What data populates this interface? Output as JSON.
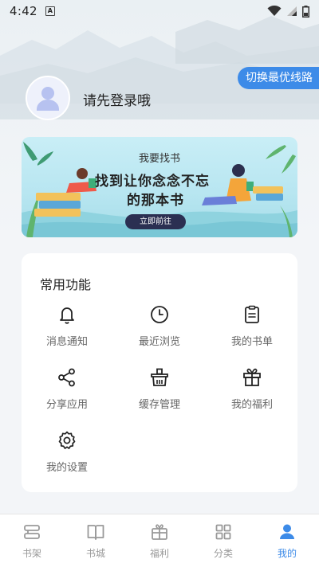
{
  "status_bar": {
    "time": "4:42",
    "notification_letter": "A"
  },
  "route_button": {
    "label": "切换最优线路"
  },
  "profile": {
    "login_prompt": "请先登录哦"
  },
  "banner": {
    "subtitle": "我要找书",
    "title_line1": "找到让你念念不忘",
    "title_line2": "的那本书",
    "button_label": "立即前往"
  },
  "functions": {
    "title": "常用功能",
    "items": [
      {
        "label": "消息通知",
        "icon": "bell-icon"
      },
      {
        "label": "最近浏览",
        "icon": "clock-icon"
      },
      {
        "label": "我的书单",
        "icon": "clipboard-icon"
      },
      {
        "label": "分享应用",
        "icon": "share-icon"
      },
      {
        "label": "缓存管理",
        "icon": "basket-icon"
      },
      {
        "label": "我的福利",
        "icon": "gift-icon"
      },
      {
        "label": "我的设置",
        "icon": "gear-icon"
      }
    ]
  },
  "bottom_nav": {
    "items": [
      {
        "label": "书架",
        "icon": "bookshelf-icon",
        "active": false
      },
      {
        "label": "书城",
        "icon": "open-book-icon",
        "active": false
      },
      {
        "label": "福利",
        "icon": "gift-box-icon",
        "active": false
      },
      {
        "label": "分类",
        "icon": "grid-icon",
        "active": false
      },
      {
        "label": "我的",
        "icon": "person-icon",
        "active": true
      }
    ],
    "active_color": "#3d8be8",
    "inactive_color": "#999999"
  },
  "colors": {
    "accent": "#3d8be8",
    "banner_button": "#2b2f52"
  }
}
